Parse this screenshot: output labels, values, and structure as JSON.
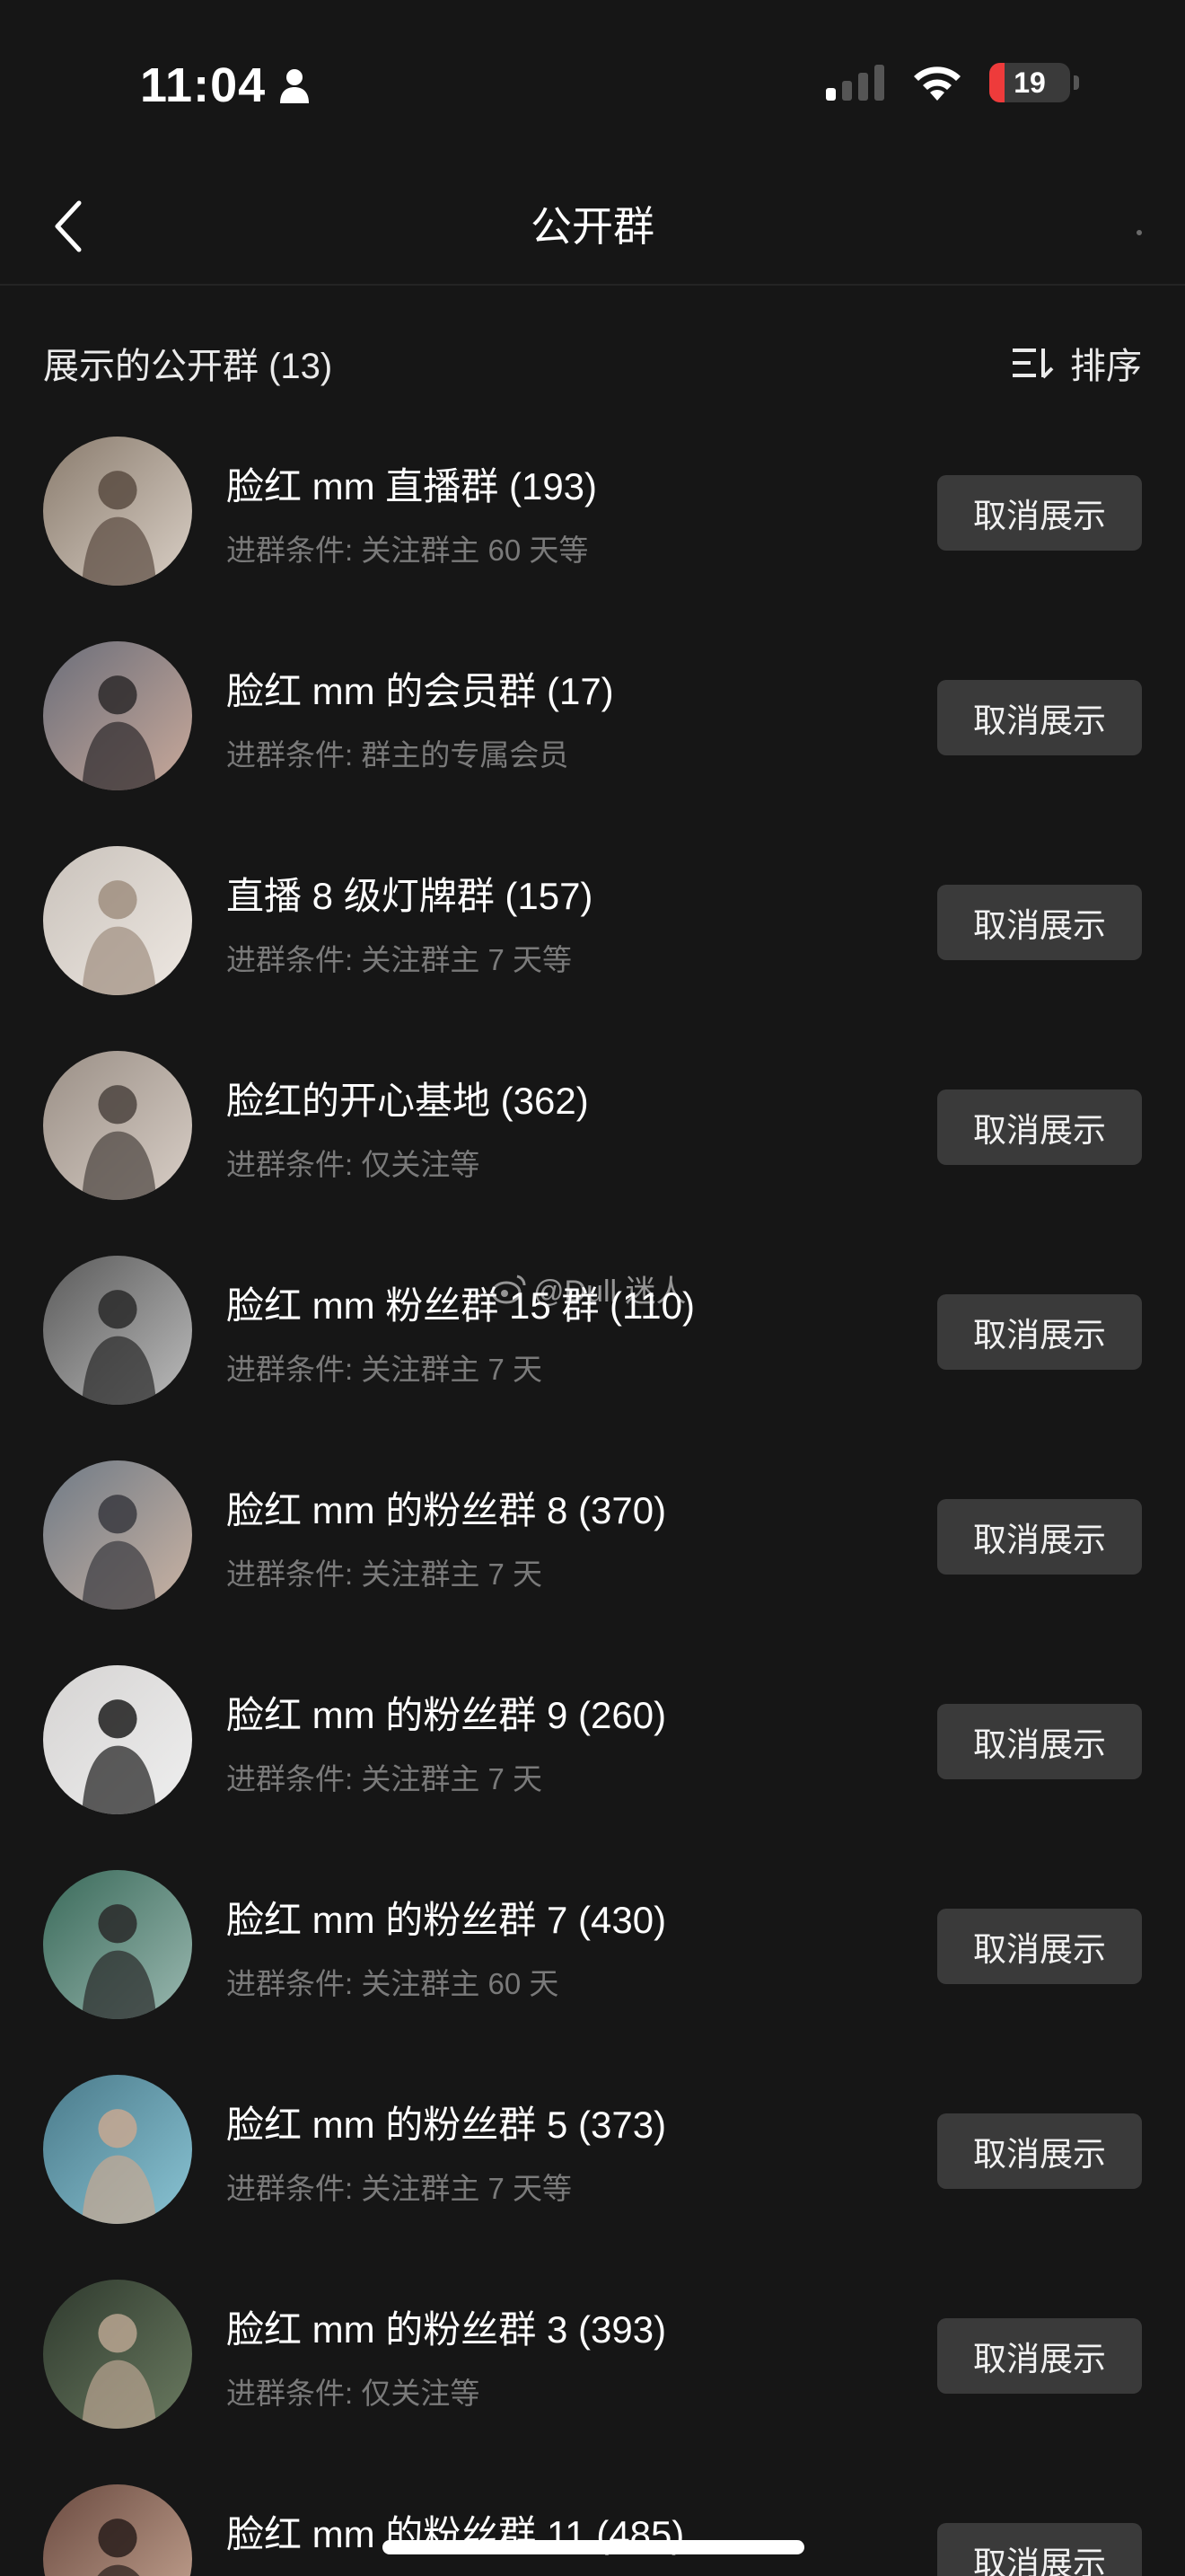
{
  "status_bar": {
    "time": "11:04",
    "battery": "19",
    "battery_level": 0.19,
    "icons": [
      "person-icon",
      "cellular-signal-icon",
      "wifi-icon",
      "battery-icon"
    ]
  },
  "nav": {
    "title": "公开群"
  },
  "section": {
    "title": "展示的公开群 (13)",
    "sort_label": "排序"
  },
  "groups": [
    {
      "name": "脸红 mm 直播群 (193)",
      "condition": "进群条件: 关注群主 60 天等",
      "button": "取消展示"
    },
    {
      "name": "脸红 mm 的会员群 (17)",
      "condition": "进群条件: 群主的专属会员",
      "button": "取消展示"
    },
    {
      "name": "直播 8 级灯牌群 (157)",
      "condition": "进群条件: 关注群主 7 天等",
      "button": "取消展示"
    },
    {
      "name": "脸红的开心基地 (362)",
      "condition": "进群条件: 仅关注等",
      "button": "取消展示"
    },
    {
      "name": "脸红 mm 粉丝群 15 群 (110)",
      "condition": "进群条件: 关注群主 7 天",
      "button": "取消展示"
    },
    {
      "name": "脸红 mm 的粉丝群 8 (370)",
      "condition": "进群条件: 关注群主 7 天",
      "button": "取消展示"
    },
    {
      "name": "脸红 mm 的粉丝群 9 (260)",
      "condition": "进群条件: 关注群主 7 天",
      "button": "取消展示"
    },
    {
      "name": "脸红 mm 的粉丝群 7 (430)",
      "condition": "进群条件: 关注群主 60 天",
      "button": "取消展示"
    },
    {
      "name": "脸红 mm 的粉丝群 5 (373)",
      "condition": "进群条件: 关注群主 7 天等",
      "button": "取消展示"
    },
    {
      "name": "脸红 mm 的粉丝群 3 (393)",
      "condition": "进群条件: 仅关注等",
      "button": "取消展示"
    },
    {
      "name": "脸红 mm 的粉丝群 11 (485)",
      "condition": "",
      "button": "取消展示"
    }
  ],
  "watermark": "@Dull 迷人",
  "colors": {
    "background": "#161616",
    "button_bg": "#3a3a3a",
    "secondary_text": "#7a7a7a",
    "battery_red": "#ee3b3b"
  }
}
